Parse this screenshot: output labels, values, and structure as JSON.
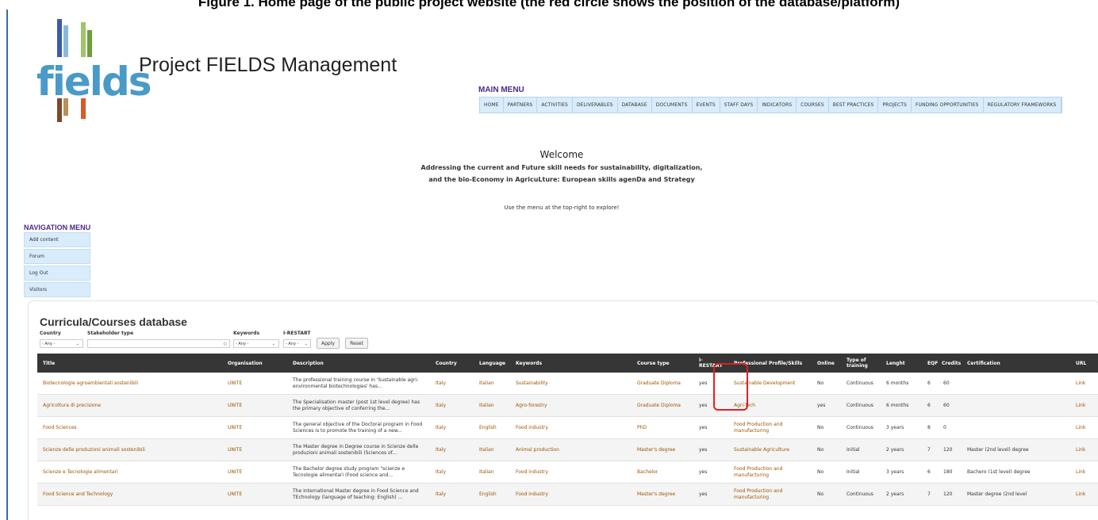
{
  "caption": "Figure 1. Home page of the public project website (the red circle shows the position of the database/platform)",
  "logo": {
    "text": "fields"
  },
  "site_title": "Project FIELDS Management",
  "main_menu": {
    "title": "MAIN MENU",
    "items": [
      "HOME",
      "PARTNERS",
      "ACTIVITIES",
      "DELIVERABLES",
      "DATABASE",
      "DOCUMENTS",
      "EVENTS",
      "STAFF DAYS",
      "INDICATORS",
      "COURSES",
      "BEST PRACTICES",
      "PROJECTS",
      "FUNDING OPPORTUNITIES",
      "REGULATORY FRAMEWORKS"
    ]
  },
  "welcome": {
    "heading": "Welcome",
    "line1": "Addressing the current and Future skill needs for sustainability, digitalization,",
    "line2": "and the bio-Economy in AgricuLture: European skills agenDa and Strategy",
    "explore": "Use the menu at the top-right to explore!"
  },
  "nav_menu": {
    "title": "NAVIGATION MENU",
    "items": [
      "Add content",
      "Forum",
      "Log Out",
      "Visitors"
    ]
  },
  "database": {
    "title": "Curricula/Courses database",
    "filters": {
      "country_label": "Country",
      "country_value": "- Any -",
      "stakeholder_label": "Stakeholder type",
      "stakeholder_value": "",
      "keywords_label": "Keywords",
      "keywords_value": "- Any -",
      "irestart_label": "I-RESTART",
      "irestart_value": "- Any -",
      "apply": "Apply",
      "reset": "Reset"
    },
    "columns": [
      "Title",
      "Organisation",
      "Description",
      "Country",
      "Language",
      "Keywords",
      "Course type",
      "I-RESTART",
      "Professional Profile/Skills",
      "Online",
      "Type of training",
      "Lenght",
      "EQF",
      "Credits",
      "Certification",
      "URL"
    ],
    "rows": [
      [
        "Biotecnologie agroambientali sostenibili",
        "UNITE",
        "The professional training course in 'Sustainable agri-environmental biotechnologies' has...",
        "Italy",
        "Italian",
        "Sustainability",
        "Graduate Diploma",
        "yes",
        "Sustainable Development",
        "No",
        "Continuous",
        "6 months",
        "6",
        "60",
        "",
        "Link"
      ],
      [
        "Agricoltura di precisione",
        "UNITE",
        "The Specialisation master (post 1st level degree) has the primary objective of conferring the...",
        "Italy",
        "Italian",
        "Agro-forestry",
        "Graduate Diploma",
        "yes",
        "Agri-Tech",
        "yes",
        "Continuous",
        "6 months",
        "6",
        "60",
        "",
        "Link"
      ],
      [
        "Food Sciences",
        "UNITE",
        "The general objective of the Doctoral program in Food Sciences is to promote the training of a new...",
        "Italy",
        "English",
        "Food industry",
        "PhD",
        "yes",
        "Food Production and manufacturing",
        "No",
        "Continuous",
        "3 years",
        "8",
        "0",
        "",
        "Link"
      ],
      [
        "Scienze delle produzioni animali sostenibili",
        "UNITE",
        "The Master degree in Degree course in Scienze delle produzioni animali sostenibili (Sciences of...",
        "Italy",
        "Italian",
        "Animal production",
        "Master's degree",
        "yes",
        "Sustainable Agriculture",
        "No",
        "Initial",
        "2 years",
        "7",
        "120",
        "Master (2nd level) degree",
        "Link"
      ],
      [
        "Scienze e Tecnologie alimentari",
        "UNITE",
        "The Bachelor degree study program \"scienze e Tecnologie alimentari (Food science and...",
        "Italy",
        "Italian",
        "Food industry",
        "Bachelor",
        "yes",
        "Food Production and manufacturing",
        "No",
        "Initial",
        "3 years",
        "6",
        "180",
        "Bachero (1st level) degree",
        "Link"
      ],
      [
        "Food Science and Technology",
        "UNITE",
        "The International Master degree in Food Science and TEchnology (language of teaching: English) ...",
        "Italy",
        "English",
        "Food industry",
        "Master's degree",
        "yes",
        "Food Production and manufacturing",
        "No",
        "Continuous",
        "2 years",
        "7",
        "120",
        "Master degree (2nd level",
        "Link"
      ]
    ]
  },
  "colors": {
    "menu_bg": "#d9ecfb",
    "menu_title": "#4b2a8a",
    "table_header": "#363636",
    "link": "#9c5400",
    "highlight": "#e02020"
  }
}
